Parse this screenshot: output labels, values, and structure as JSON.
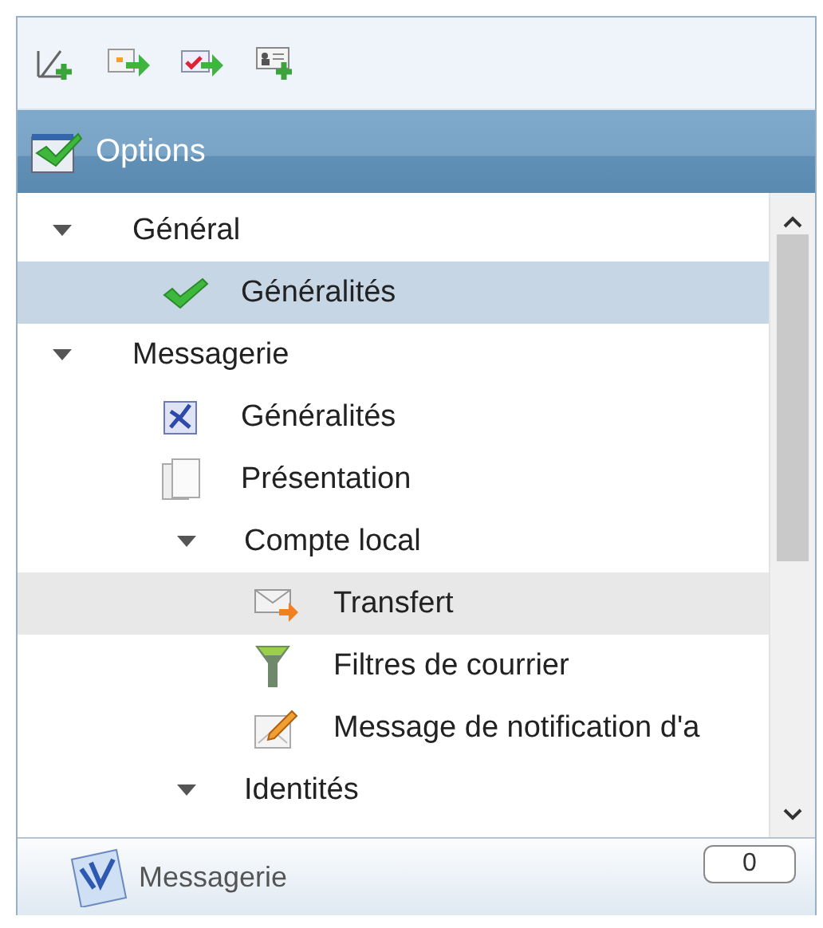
{
  "toolbar": {
    "buttons": [
      {
        "kind": "pen"
      },
      {
        "kind": "calendar"
      },
      {
        "kind": "task"
      },
      {
        "kind": "contact"
      }
    ]
  },
  "header": {
    "title": "Options"
  },
  "tree": [
    {
      "label": "Général",
      "kind": "group",
      "expanded": true,
      "selected": false,
      "hovered": false,
      "children": [
        {
          "label": "Généralités",
          "kind": "leaf",
          "selected": true,
          "hovered": false
        }
      ]
    },
    {
      "label": "Messagerie",
      "kind": "group",
      "expanded": true,
      "selected": false,
      "hovered": false,
      "children": [
        {
          "label": "Généralités",
          "kind": "leaf",
          "selected": false,
          "hovered": false
        },
        {
          "label": "Présentation",
          "kind": "leaf",
          "selected": false,
          "hovered": false
        },
        {
          "label": "Compte local",
          "kind": "group",
          "expanded": true,
          "selected": false,
          "hovered": false,
          "children": [
            {
              "label": "Transfert",
              "kind": "leaf",
              "selected": false,
              "hovered": true
            },
            {
              "label": "Filtres de courrier",
              "kind": "leaf",
              "selected": false,
              "hovered": false
            },
            {
              "label": "Message de notification d'a",
              "kind": "leaf",
              "selected": false,
              "hovered": false
            }
          ]
        },
        {
          "label": "Identités",
          "kind": "group",
          "expanded": true,
          "selected": false,
          "hovered": false
        }
      ]
    }
  ],
  "footer": {
    "label": "Messagerie",
    "count": "0"
  }
}
